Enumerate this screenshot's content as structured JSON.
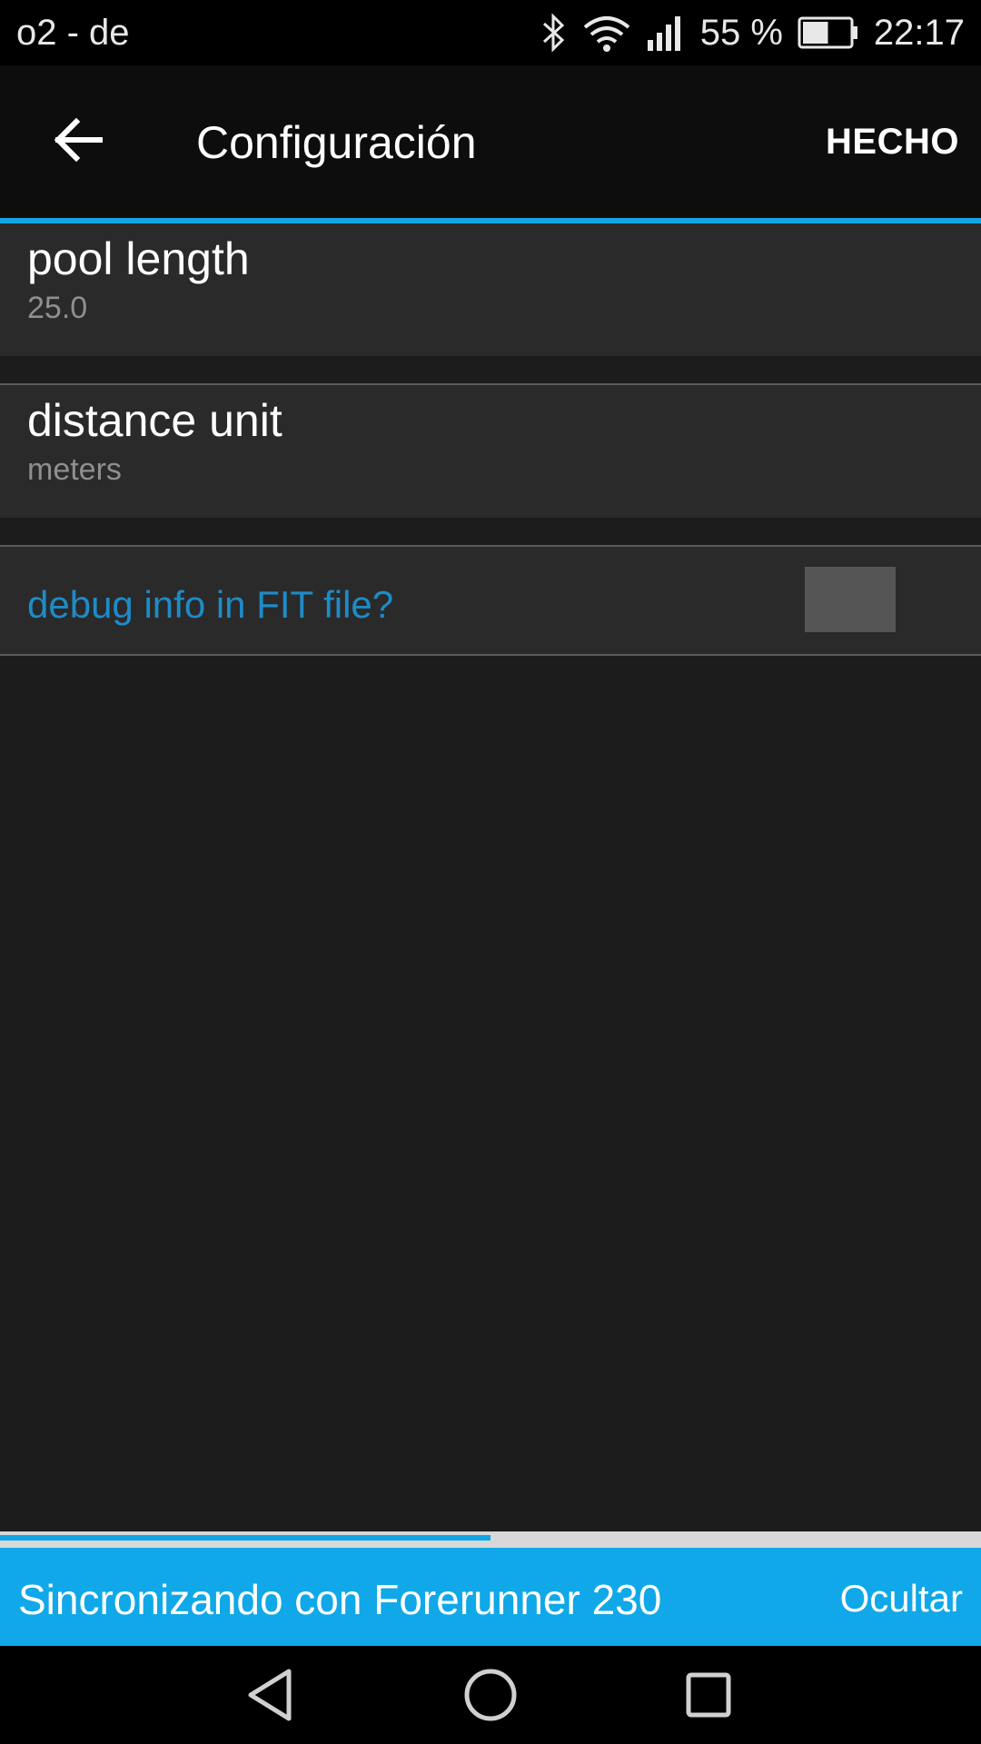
{
  "status_bar": {
    "carrier": "o2 - de",
    "battery_percent": "55 %",
    "battery_level": 0.55,
    "time": "22:17",
    "icons": [
      "bluetooth-icon",
      "wifi-icon",
      "signal-icon",
      "battery-icon"
    ]
  },
  "action_bar": {
    "back_icon": "arrow-left-icon",
    "title": "Configuración",
    "done_label": "HECHO"
  },
  "settings": {
    "pool_length": {
      "title": "pool length",
      "value": "25.0"
    },
    "distance_unit": {
      "title": "distance unit",
      "value": "meters"
    },
    "debug_info": {
      "label": "debug info in FIT file?",
      "checked": false
    }
  },
  "sync_banner": {
    "text": "Sincronizando con Forerunner 230",
    "hide_label": "Ocultar",
    "progress": 0.5
  },
  "nav_bar": {
    "icons": [
      "nav-back-icon",
      "nav-home-icon",
      "nav-recent-icon"
    ]
  },
  "colors": {
    "accent": "#0fa6e6",
    "link_text": "#1e8bc9",
    "banner": "#10a8e8",
    "background": "#1c1c1c",
    "item_background": "#2a2a2a"
  }
}
